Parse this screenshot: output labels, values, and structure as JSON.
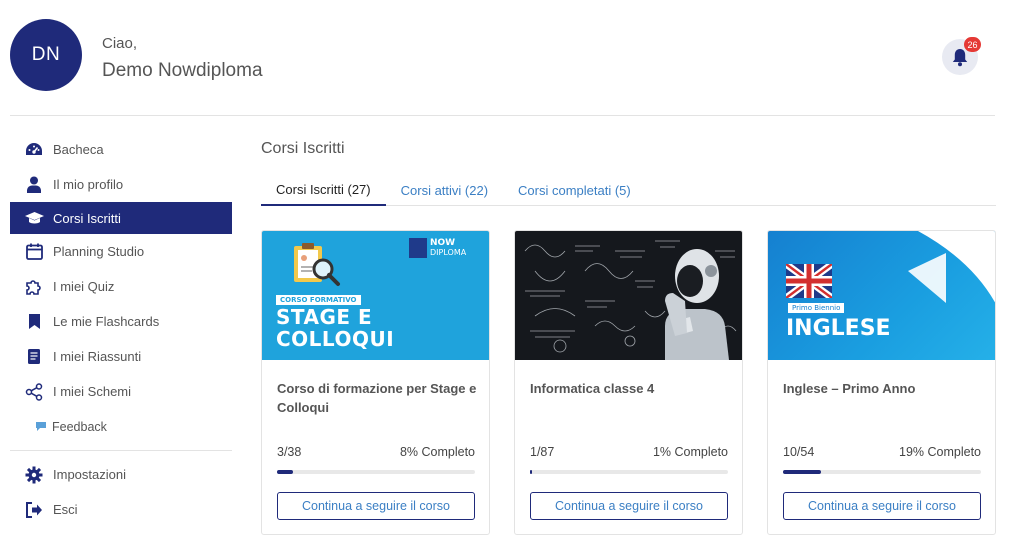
{
  "user": {
    "initials": "DN",
    "greeting": "Ciao,",
    "name": "Demo Nowdiploma"
  },
  "notifications": {
    "count": "26"
  },
  "sidebar": {
    "items": [
      {
        "label": "Bacheca",
        "icon": "dashboard-icon"
      },
      {
        "label": "Il mio profilo",
        "icon": "user-icon"
      },
      {
        "label": "Corsi Iscritti",
        "icon": "graduation-cap-icon",
        "active": true
      },
      {
        "label": "Planning Studio",
        "icon": "calendar-icon"
      },
      {
        "label": "I miei Quiz",
        "icon": "puzzle-icon"
      },
      {
        "label": "Le mie Flashcards",
        "icon": "bookmark-icon"
      },
      {
        "label": "I miei Riassunti",
        "icon": "document-icon"
      },
      {
        "label": "I miei Schemi",
        "icon": "share-nodes-icon"
      },
      {
        "label": "Feedback",
        "icon": "comment-icon"
      }
    ],
    "bottom": [
      {
        "label": "Impostazioni",
        "icon": "gear-icon"
      },
      {
        "label": "Esci",
        "icon": "sign-out-icon"
      }
    ]
  },
  "main": {
    "title": "Corsi Iscritti",
    "tabs": [
      {
        "label": "Corsi Iscritti (27)",
        "active": true
      },
      {
        "label": "Corsi attivi (22)"
      },
      {
        "label": "Corsi completati (5)"
      }
    ]
  },
  "cards": [
    {
      "title": "Corso di formazione per Stage e Colloqui",
      "progress_count": "3/38",
      "progress_label": "8% Completo",
      "progress": 0.08,
      "button": "Continua a seguire il corso",
      "image": {
        "tag": "CORSO FORMATIVO",
        "line1": "STAGE E",
        "line2": "COLLOQUI",
        "brand1": "NOW",
        "brand2": "DIPLOMA"
      }
    },
    {
      "title": "Informatica classe 4",
      "progress_count": "1/87",
      "progress_label": "1% Completo",
      "progress": 0.01,
      "button": "Continua a seguire il corso"
    },
    {
      "title": "Inglese – Primo Anno",
      "progress_count": "10/54",
      "progress_label": "19% Completo",
      "progress": 0.19,
      "button": "Continua a seguire il corso",
      "image": {
        "tag": "Primo Biennio",
        "line1": "INGLESE"
      }
    }
  ],
  "colors": {
    "primary": "#1f2a7a",
    "link": "#3b7fc4",
    "badge": "#e53935"
  }
}
